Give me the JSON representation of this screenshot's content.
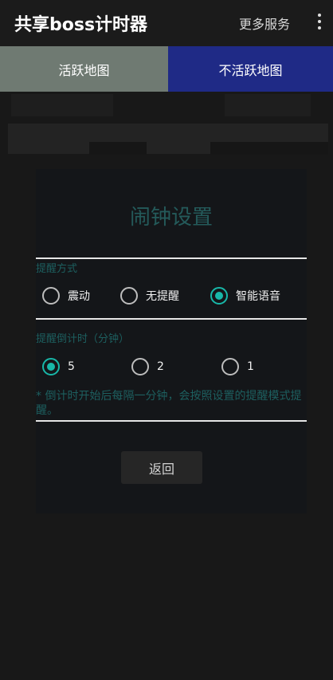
{
  "header": {
    "title": "共享boss计时器",
    "more_services": "更多服务"
  },
  "tabs": [
    {
      "label": "活跃地图",
      "selected": true
    },
    {
      "label": "不活跃地图",
      "selected": false
    }
  ],
  "dialog": {
    "title": "闹钟设置",
    "reminder_method": {
      "label": "提醒方式",
      "options": [
        {
          "label": "震动",
          "checked": false
        },
        {
          "label": "无提醒",
          "checked": false
        },
        {
          "label": "智能语音",
          "checked": true
        }
      ]
    },
    "countdown": {
      "label": "提醒倒计时（分钟）",
      "options": [
        {
          "label": "5",
          "checked": true
        },
        {
          "label": "2",
          "checked": false
        },
        {
          "label": "1",
          "checked": false
        }
      ]
    },
    "note": "* 倒计时开始后每隔一分钟，会按照设置的提醒模式提醒。",
    "back_button": "返回"
  },
  "colors": {
    "accent": "#18b7a8",
    "tab_active": "#6f7a72",
    "tab_inactive": "#1f2a86",
    "dim_teal_text": "#1d5f5f"
  },
  "icons": {
    "overflow": "more-vertical-icon"
  }
}
